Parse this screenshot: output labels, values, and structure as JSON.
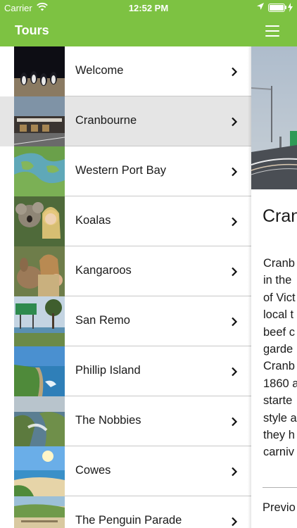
{
  "status_bar": {
    "carrier": "Carrier",
    "time": "12:52 PM",
    "icons": [
      "wifi-icon",
      "location-icon",
      "battery-icon",
      "charging-bolt-icon"
    ]
  },
  "nav": {
    "title": "Tours",
    "menu_icon": "hamburger-menu-icon"
  },
  "colors": {
    "accent": "#7dc242",
    "selected_row": "#e5e5e5",
    "separator": "#c8c8c8",
    "text": "#1a1a1a"
  },
  "tours": [
    {
      "label": "Welcome",
      "selected": false
    },
    {
      "label": "Cranbourne",
      "selected": true
    },
    {
      "label": "Western Port Bay",
      "selected": false
    },
    {
      "label": "Koalas",
      "selected": false
    },
    {
      "label": "Kangaroos",
      "selected": false
    },
    {
      "label": "San Remo",
      "selected": false
    },
    {
      "label": "Phillip Island",
      "selected": false
    },
    {
      "label": "The Nobbies",
      "selected": false
    },
    {
      "label": "Cowes",
      "selected": false
    },
    {
      "label": "The Penguin Parade",
      "selected": false
    }
  ],
  "detail": {
    "title": "Cran",
    "lines": [
      "Cranb",
      "in the",
      "of Vict",
      "local t",
      "beef c",
      "garde",
      "Cranb",
      "1860 a",
      "starte",
      "style a",
      "they h",
      "carniv"
    ],
    "prev_label": "Previo"
  }
}
